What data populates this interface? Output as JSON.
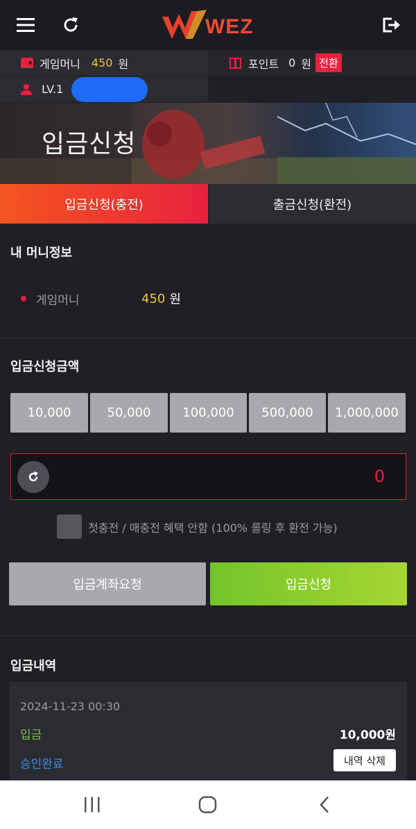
{
  "header": {
    "logo_text": "WEZ",
    "menu_icon": "hamburger-menu-icon",
    "refresh_icon": "refresh-icon",
    "logout_icon": "logout-icon"
  },
  "account": {
    "game_money_label": "게임머니",
    "game_money_value": "450",
    "game_money_unit": "원",
    "point_label": "포인트",
    "point_value": "0",
    "point_unit": "원",
    "convert_button": "전환",
    "level_label": "LV.1"
  },
  "banner": {
    "title": "입금신청"
  },
  "tabs": [
    {
      "label": "입금신청(충전)",
      "active": true
    },
    {
      "label": "출금신청(환전)",
      "active": false
    }
  ],
  "money_info": {
    "section_title": "내 머니정보",
    "label": "게임머니",
    "value": "450",
    "unit": "원"
  },
  "deposit_amount": {
    "section_title": "입금신청금액",
    "presets": [
      "10,000",
      "50,000",
      "100,000",
      "500,000",
      "1,000,000"
    ],
    "input_value": "0"
  },
  "bonus_option": {
    "label": "첫충전 / 매충전 혜택 안함 (100% 롤링 후 환전 가능)",
    "checked": false
  },
  "actions": {
    "request_account": "입금계좌요청",
    "submit_deposit": "입금신청"
  },
  "history": {
    "section_title": "입금내역",
    "items": [
      {
        "datetime": "2024-11-23 00:30",
        "type": "입금",
        "amount": "10,000원",
        "status": "승인완료",
        "delete_button": "내역 삭제"
      }
    ]
  },
  "colors": {
    "accent_red": "#e8213e",
    "gold": "#f5c33b",
    "green": "#8fd22e",
    "status_blue": "#3d8ee8",
    "type_green": "#7cc243"
  }
}
